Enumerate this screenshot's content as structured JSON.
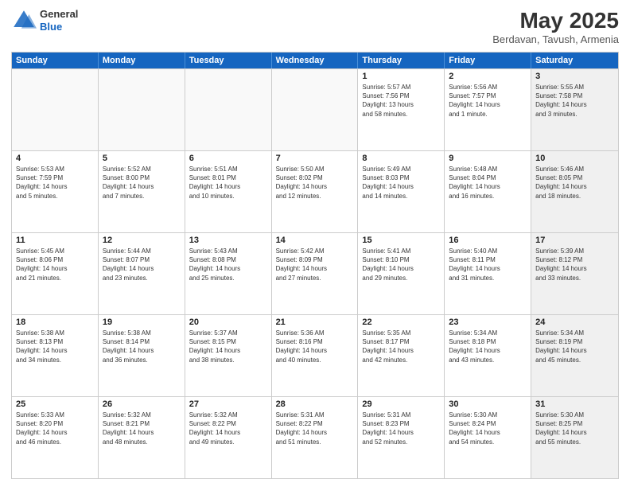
{
  "header": {
    "logo": {
      "general": "General",
      "blue": "Blue"
    },
    "title": "May 2025",
    "location": "Berdavan, Tavush, Armenia"
  },
  "calendar": {
    "days": [
      "Sunday",
      "Monday",
      "Tuesday",
      "Wednesday",
      "Thursday",
      "Friday",
      "Saturday"
    ],
    "rows": [
      [
        {
          "day": "",
          "empty": true
        },
        {
          "day": "",
          "empty": true
        },
        {
          "day": "",
          "empty": true
        },
        {
          "day": "",
          "empty": true
        },
        {
          "day": "1",
          "lines": [
            "Sunrise: 5:57 AM",
            "Sunset: 7:56 PM",
            "Daylight: 13 hours",
            "and 58 minutes."
          ]
        },
        {
          "day": "2",
          "lines": [
            "Sunrise: 5:56 AM",
            "Sunset: 7:57 PM",
            "Daylight: 14 hours",
            "and 1 minute."
          ]
        },
        {
          "day": "3",
          "lines": [
            "Sunrise: 5:55 AM",
            "Sunset: 7:58 PM",
            "Daylight: 14 hours",
            "and 3 minutes."
          ],
          "shaded": true
        }
      ],
      [
        {
          "day": "4",
          "lines": [
            "Sunrise: 5:53 AM",
            "Sunset: 7:59 PM",
            "Daylight: 14 hours",
            "and 5 minutes."
          ]
        },
        {
          "day": "5",
          "lines": [
            "Sunrise: 5:52 AM",
            "Sunset: 8:00 PM",
            "Daylight: 14 hours",
            "and 7 minutes."
          ]
        },
        {
          "day": "6",
          "lines": [
            "Sunrise: 5:51 AM",
            "Sunset: 8:01 PM",
            "Daylight: 14 hours",
            "and 10 minutes."
          ]
        },
        {
          "day": "7",
          "lines": [
            "Sunrise: 5:50 AM",
            "Sunset: 8:02 PM",
            "Daylight: 14 hours",
            "and 12 minutes."
          ]
        },
        {
          "day": "8",
          "lines": [
            "Sunrise: 5:49 AM",
            "Sunset: 8:03 PM",
            "Daylight: 14 hours",
            "and 14 minutes."
          ]
        },
        {
          "day": "9",
          "lines": [
            "Sunrise: 5:48 AM",
            "Sunset: 8:04 PM",
            "Daylight: 14 hours",
            "and 16 minutes."
          ]
        },
        {
          "day": "10",
          "lines": [
            "Sunrise: 5:46 AM",
            "Sunset: 8:05 PM",
            "Daylight: 14 hours",
            "and 18 minutes."
          ],
          "shaded": true
        }
      ],
      [
        {
          "day": "11",
          "lines": [
            "Sunrise: 5:45 AM",
            "Sunset: 8:06 PM",
            "Daylight: 14 hours",
            "and 21 minutes."
          ]
        },
        {
          "day": "12",
          "lines": [
            "Sunrise: 5:44 AM",
            "Sunset: 8:07 PM",
            "Daylight: 14 hours",
            "and 23 minutes."
          ]
        },
        {
          "day": "13",
          "lines": [
            "Sunrise: 5:43 AM",
            "Sunset: 8:08 PM",
            "Daylight: 14 hours",
            "and 25 minutes."
          ]
        },
        {
          "day": "14",
          "lines": [
            "Sunrise: 5:42 AM",
            "Sunset: 8:09 PM",
            "Daylight: 14 hours",
            "and 27 minutes."
          ]
        },
        {
          "day": "15",
          "lines": [
            "Sunrise: 5:41 AM",
            "Sunset: 8:10 PM",
            "Daylight: 14 hours",
            "and 29 minutes."
          ]
        },
        {
          "day": "16",
          "lines": [
            "Sunrise: 5:40 AM",
            "Sunset: 8:11 PM",
            "Daylight: 14 hours",
            "and 31 minutes."
          ]
        },
        {
          "day": "17",
          "lines": [
            "Sunrise: 5:39 AM",
            "Sunset: 8:12 PM",
            "Daylight: 14 hours",
            "and 33 minutes."
          ],
          "shaded": true
        }
      ],
      [
        {
          "day": "18",
          "lines": [
            "Sunrise: 5:38 AM",
            "Sunset: 8:13 PM",
            "Daylight: 14 hours",
            "and 34 minutes."
          ]
        },
        {
          "day": "19",
          "lines": [
            "Sunrise: 5:38 AM",
            "Sunset: 8:14 PM",
            "Daylight: 14 hours",
            "and 36 minutes."
          ]
        },
        {
          "day": "20",
          "lines": [
            "Sunrise: 5:37 AM",
            "Sunset: 8:15 PM",
            "Daylight: 14 hours",
            "and 38 minutes."
          ]
        },
        {
          "day": "21",
          "lines": [
            "Sunrise: 5:36 AM",
            "Sunset: 8:16 PM",
            "Daylight: 14 hours",
            "and 40 minutes."
          ]
        },
        {
          "day": "22",
          "lines": [
            "Sunrise: 5:35 AM",
            "Sunset: 8:17 PM",
            "Daylight: 14 hours",
            "and 42 minutes."
          ]
        },
        {
          "day": "23",
          "lines": [
            "Sunrise: 5:34 AM",
            "Sunset: 8:18 PM",
            "Daylight: 14 hours",
            "and 43 minutes."
          ]
        },
        {
          "day": "24",
          "lines": [
            "Sunrise: 5:34 AM",
            "Sunset: 8:19 PM",
            "Daylight: 14 hours",
            "and 45 minutes."
          ],
          "shaded": true
        }
      ],
      [
        {
          "day": "25",
          "lines": [
            "Sunrise: 5:33 AM",
            "Sunset: 8:20 PM",
            "Daylight: 14 hours",
            "and 46 minutes."
          ]
        },
        {
          "day": "26",
          "lines": [
            "Sunrise: 5:32 AM",
            "Sunset: 8:21 PM",
            "Daylight: 14 hours",
            "and 48 minutes."
          ]
        },
        {
          "day": "27",
          "lines": [
            "Sunrise: 5:32 AM",
            "Sunset: 8:22 PM",
            "Daylight: 14 hours",
            "and 49 minutes."
          ]
        },
        {
          "day": "28",
          "lines": [
            "Sunrise: 5:31 AM",
            "Sunset: 8:22 PM",
            "Daylight: 14 hours",
            "and 51 minutes."
          ]
        },
        {
          "day": "29",
          "lines": [
            "Sunrise: 5:31 AM",
            "Sunset: 8:23 PM",
            "Daylight: 14 hours",
            "and 52 minutes."
          ]
        },
        {
          "day": "30",
          "lines": [
            "Sunrise: 5:30 AM",
            "Sunset: 8:24 PM",
            "Daylight: 14 hours",
            "and 54 minutes."
          ]
        },
        {
          "day": "31",
          "lines": [
            "Sunrise: 5:30 AM",
            "Sunset: 8:25 PM",
            "Daylight: 14 hours",
            "and 55 minutes."
          ],
          "shaded": true
        }
      ]
    ]
  }
}
